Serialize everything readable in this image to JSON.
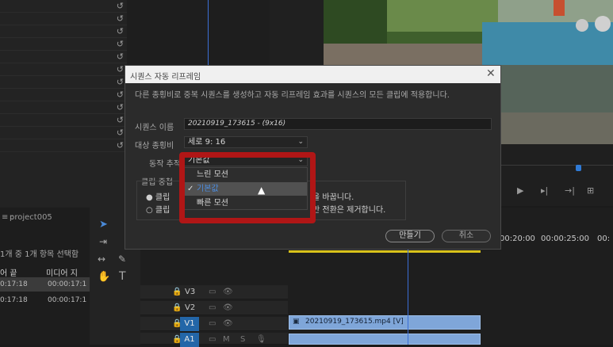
{
  "project": {
    "tab": "project005",
    "selection_text": "1개 중 1개 항목 선택함",
    "col_out": "어 끝",
    "col_media": "미디어 지",
    "rows": [
      {
        "a": "0:17:18",
        "b": "00:00:17:1"
      },
      {
        "a": "0:17:18",
        "b": "00:00:17:1"
      }
    ]
  },
  "timeline": {
    "ruler": [
      "00:20:00",
      "00:00:25:00",
      "00:"
    ],
    "tracks": [
      "V3",
      "V2",
      "V1",
      "A1"
    ],
    "clip_label": "20210919_173615.mp4 [V]"
  },
  "dialog": {
    "title": "시퀀스 자동 리프레임",
    "description": "다른 종횡비로 중복 시퀀스를 생성하고 자동 리프레임 효과를 시퀀스의 모든 클립에 적용합니다.",
    "seq_name_label": "시퀀스 이름",
    "seq_name_value": "20210919_173615 - (9x16)",
    "aspect_label": "대상 종횡비",
    "aspect_prefix": "세로",
    "aspect_value": "9: 16",
    "motion_label": "동작 추적",
    "motion_value": "기본값",
    "clip_nesting_label": "클립 중첩",
    "radio1_left": "클립",
    "radio1_right": "을 바꿉니다.",
    "radio2_left": "클립",
    "radio2_right": "만 전환은 제거합니다.",
    "ok_button": "만들기",
    "cancel_button": "취소",
    "close_glyph": "✕"
  },
  "dropdown": {
    "items": [
      "느린 모션",
      "기본값",
      "빠른 모션"
    ],
    "selected_index": 1,
    "check": "✓"
  },
  "tool_glyphs": {
    "text_tool": "T"
  }
}
